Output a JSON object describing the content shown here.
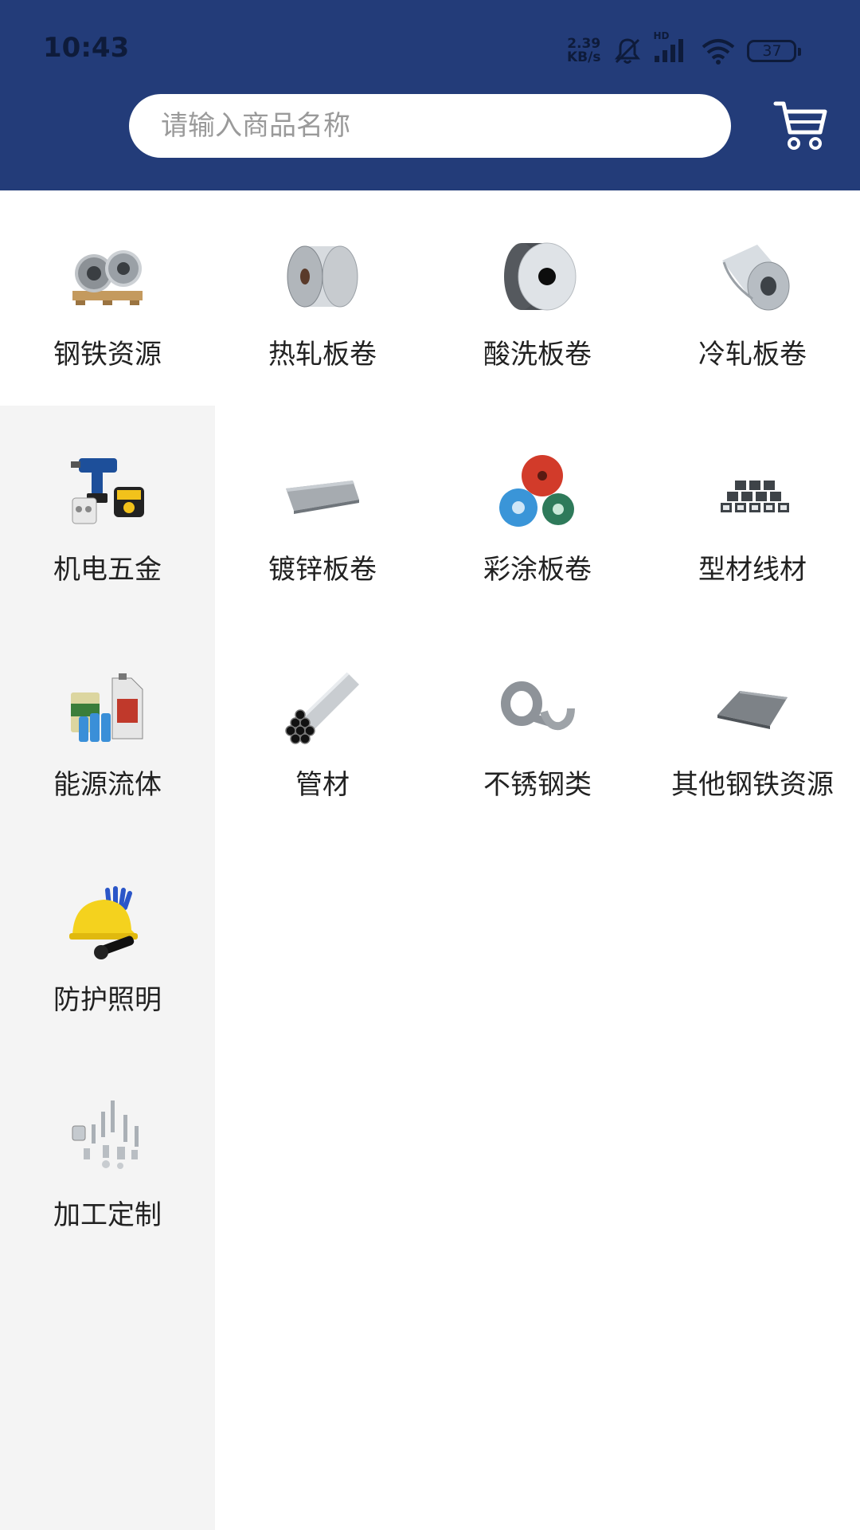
{
  "status_bar": {
    "time": "10:43",
    "net_speed_value": "2.39",
    "net_speed_unit": "KB/s",
    "network_label": "HD",
    "battery": "37"
  },
  "search": {
    "placeholder": "请输入商品名称",
    "icon": "cart-icon"
  },
  "sidebar": {
    "items": [
      {
        "label": "钢铁资源",
        "icon": "steel-coils-icon",
        "active": true
      },
      {
        "label": "机电五金",
        "icon": "power-tools-icon",
        "active": false
      },
      {
        "label": "能源流体",
        "icon": "oil-paint-cans-icon",
        "active": false
      },
      {
        "label": "防护照明",
        "icon": "helmet-flashlight-icon",
        "active": false
      },
      {
        "label": "加工定制",
        "icon": "fasteners-icon",
        "active": false
      }
    ]
  },
  "grid": {
    "items": [
      {
        "label": "热轧板卷",
        "icon": "hot-rolled-coil-icon"
      },
      {
        "label": "酸洗板卷",
        "icon": "pickled-coil-icon"
      },
      {
        "label": "冷轧板卷",
        "icon": "cold-rolled-coil-icon"
      },
      {
        "label": "镀锌板卷",
        "icon": "galvanized-sheet-icon"
      },
      {
        "label": "彩涂板卷",
        "icon": "color-coated-coil-icon"
      },
      {
        "label": "型材线材",
        "icon": "steel-profiles-icon"
      },
      {
        "label": "管材",
        "icon": "steel-pipes-icon"
      },
      {
        "label": "不锈钢类",
        "icon": "stainless-coil-icon"
      },
      {
        "label": "其他钢铁资源",
        "icon": "steel-plate-icon"
      }
    ]
  },
  "colors": {
    "header_bg": "#233c79",
    "sidebar_bg": "#f4f4f4",
    "text": "#222222"
  }
}
